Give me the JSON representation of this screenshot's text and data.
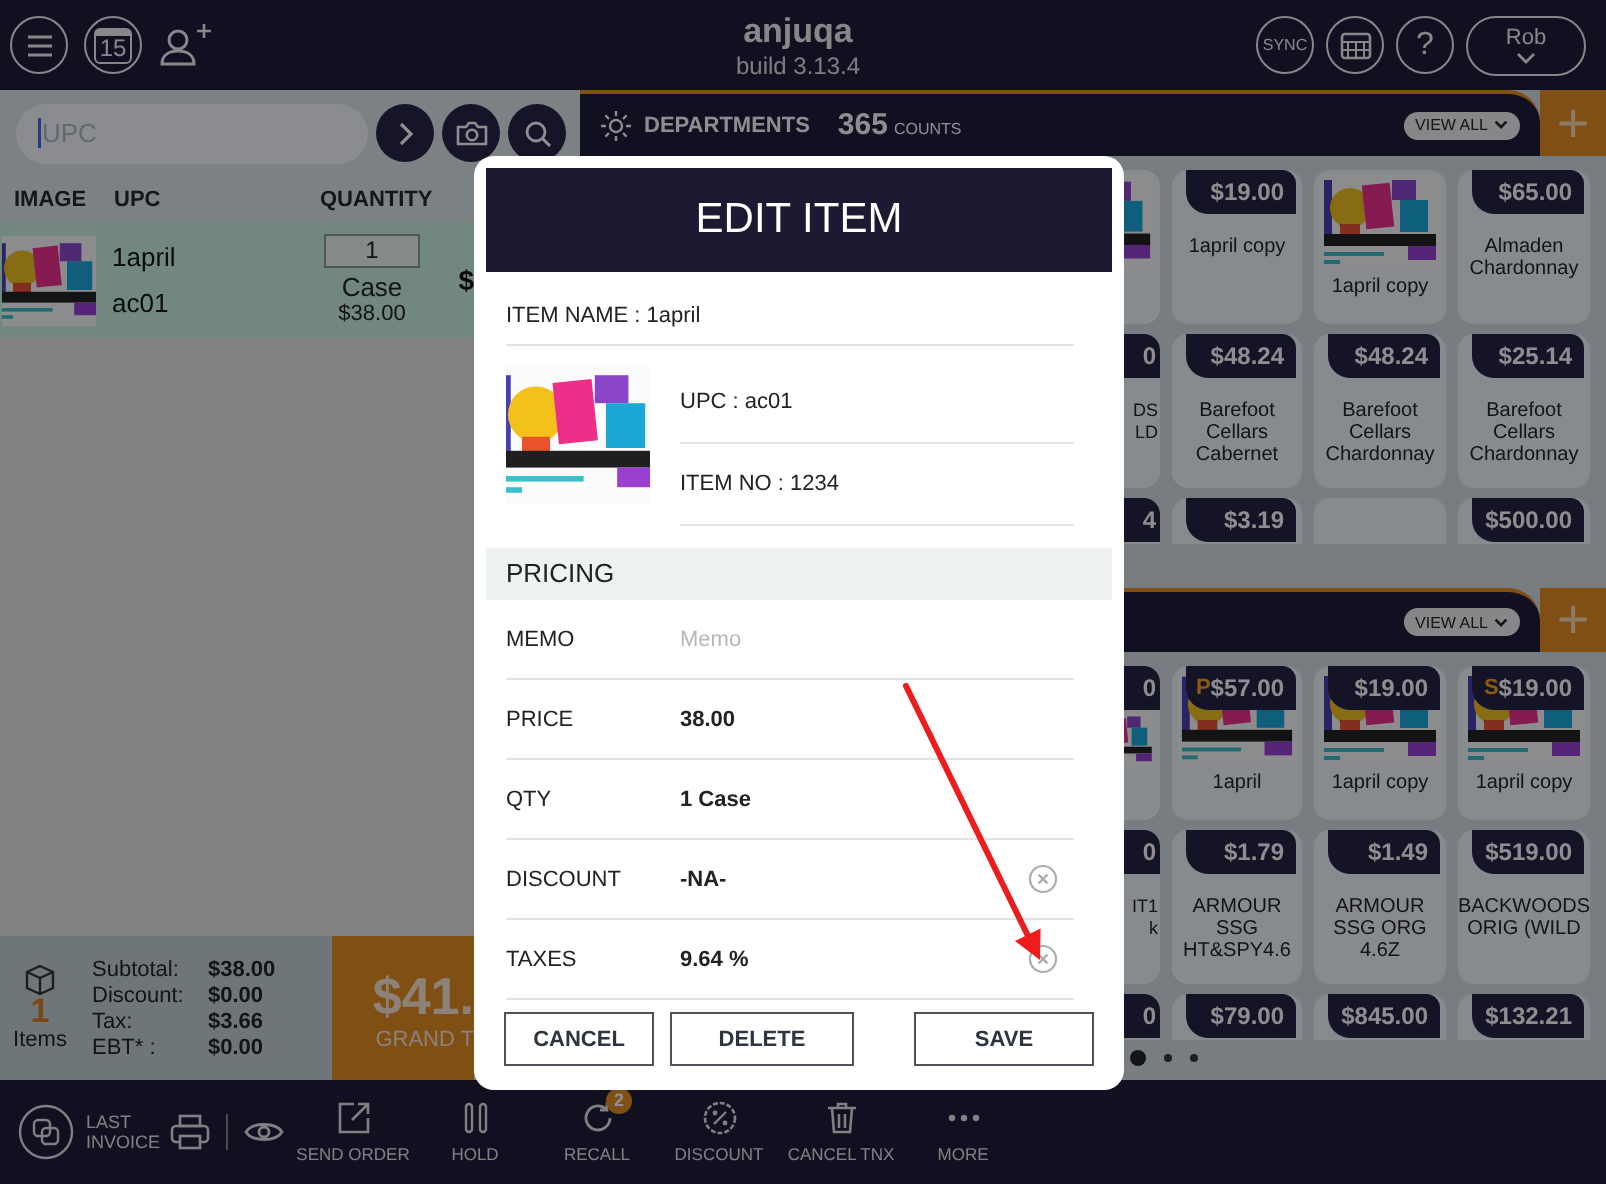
{
  "top_bar": {
    "title": "anjuqa",
    "build": "build 3.13.4",
    "calendar_day": "15",
    "sync": "SYNC",
    "help": "?",
    "user": "Rob"
  },
  "order_panel": {
    "search": {
      "placeholder": "UPC"
    },
    "columns": [
      "IMAGE",
      "UPC",
      "QUANTITY"
    ],
    "rows": [
      {
        "upc": "1april",
        "code": "ac01",
        "quantity": "1",
        "unit": "Case",
        "unit_price": "$38.00",
        "column_4": "$",
        "selected": true
      }
    ],
    "totals": {
      "count": "1",
      "count_label": "Items",
      "lines": [
        {
          "label": "Subtotal:",
          "value": "$38.00"
        },
        {
          "label": "Discount:",
          "value": "$0.00"
        },
        {
          "label": "Tax:",
          "value": "$3.66"
        },
        {
          "label": "EBT* :",
          "value": "$0.00"
        }
      ],
      "grand_total": "$41.",
      "grand_total_label": "GRAND T"
    }
  },
  "catalog": {
    "sections": [
      {
        "title": "DEPARTMENTS",
        "count": "365",
        "count_label": "COUNTS",
        "view_all": "VIEW ALL",
        "add": "+",
        "tiles": [
          {
            "kind": "picture"
          },
          {
            "kind": "plain",
            "price": "$19.00",
            "name": "1april copy"
          },
          {
            "kind": "picture",
            "name": "1april copy"
          },
          {
            "kind": "plain",
            "price": "$65.00",
            "name": "Almaden Chardonnay"
          },
          {
            "kind": "plain",
            "price": "0",
            "name": "DS LD"
          },
          {
            "kind": "plain",
            "price": "$48.24",
            "name": "Barefoot Cellars Cabernet"
          },
          {
            "kind": "plain",
            "price": "$48.24",
            "name": "Barefoot Cellars Chardonnay"
          },
          {
            "kind": "plain",
            "price": "$25.14",
            "name": "Barefoot Cellars Chardonnay"
          },
          {
            "kind": "plain",
            "price": "4"
          },
          {
            "kind": "plain",
            "price": "$3.19"
          },
          {
            "kind": "plain"
          },
          {
            "kind": "plain",
            "price": "$500.00"
          }
        ]
      },
      {
        "view_all": "VIEW ALL",
        "add": "+",
        "tiles": [
          {
            "kind": "picture",
            "price": "0"
          },
          {
            "kind": "picture",
            "badge": "P",
            "price": "$57.00",
            "name": "1april"
          },
          {
            "kind": "picture",
            "price": "$19.00",
            "name": "1april copy"
          },
          {
            "kind": "picture",
            "badge": "S",
            "price": "$19.00",
            "name": "1april copy"
          },
          {
            "kind": "plain",
            "price": "0",
            "name": "IT1 k"
          },
          {
            "kind": "plain",
            "price": "$1.79",
            "name": "ARMOUR SSG HT&SPY4.6"
          },
          {
            "kind": "plain",
            "price": "$1.49",
            "name": "ARMOUR SSG ORG 4.6Z"
          },
          {
            "kind": "plain",
            "price": "$519.00",
            "name": "BACKWOODS ORIG (WILD"
          },
          {
            "kind": "plain",
            "price": "0"
          },
          {
            "kind": "plain",
            "price": "$79.00"
          },
          {
            "kind": "plain",
            "price": "$845.00"
          },
          {
            "kind": "plain",
            "price": "$132.21"
          }
        ]
      }
    ],
    "pages": [
      {
        "selected": true
      },
      {
        "selected": false
      },
      {
        "selected": false
      }
    ]
  },
  "bottom_bar": {
    "last_invoice": "LAST INVOICE",
    "actions": [
      {
        "kind": "send",
        "label": "SEND ORDER"
      },
      {
        "kind": "hold",
        "label": "HOLD"
      },
      {
        "kind": "recall",
        "label": "RECALL",
        "badge": "2"
      },
      {
        "kind": "discount",
        "label": "DISCOUNT"
      },
      {
        "kind": "cancel",
        "label": "CANCEL TNX"
      },
      {
        "kind": "more",
        "label": "MORE"
      }
    ]
  },
  "edit_item": {
    "title": "EDIT ITEM",
    "item_name": "ITEM NAME : 1april",
    "upc": "UPC : ac01",
    "item_no": "ITEM NO : 1234",
    "section": "PRICING",
    "fields": [
      {
        "kind": "input",
        "label": "MEMO",
        "placeholder": "Memo",
        "clearable": false
      },
      {
        "kind": "text",
        "label": "PRICE",
        "value": "38.00",
        "clearable": false
      },
      {
        "kind": "text",
        "label": "QTY",
        "value": "1 Case",
        "clearable": false
      },
      {
        "kind": "text",
        "label": "DISCOUNT",
        "value": "-NA-",
        "clearable": true
      },
      {
        "kind": "text",
        "label": "TAXES",
        "value": "9.64 %",
        "clearable": true
      }
    ],
    "buttons": [
      "CANCEL",
      "DELETE",
      "SAVE"
    ]
  },
  "annotations": [
    {
      "kind": "arrow"
    }
  ]
}
